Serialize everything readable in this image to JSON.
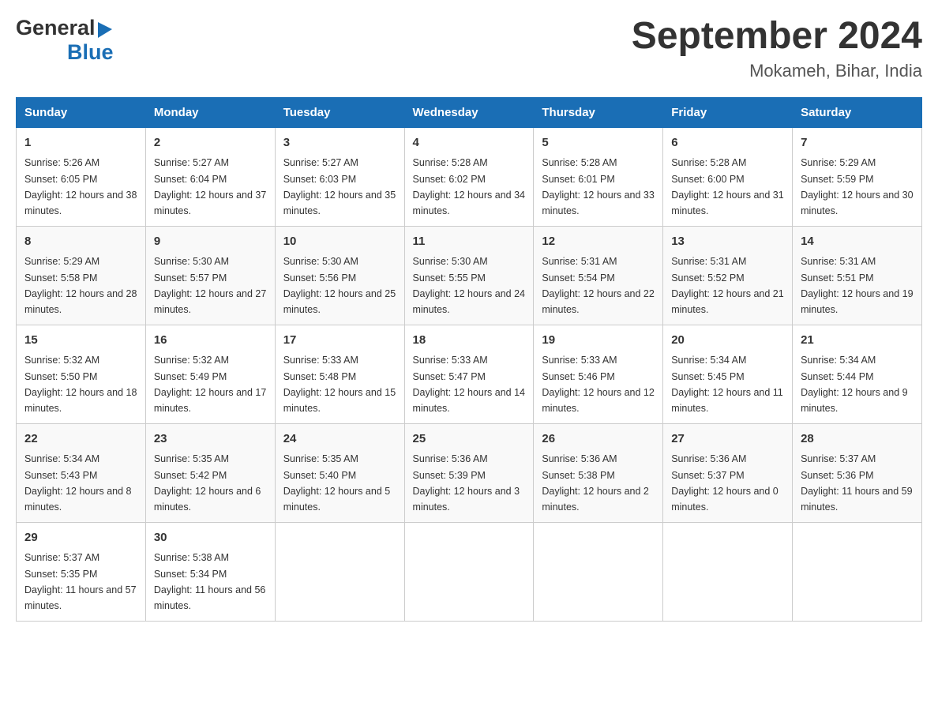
{
  "header": {
    "logo": {
      "general": "General",
      "blue": "Blue"
    },
    "title": "September 2024",
    "location": "Mokameh, Bihar, India"
  },
  "columns": [
    "Sunday",
    "Monday",
    "Tuesday",
    "Wednesday",
    "Thursday",
    "Friday",
    "Saturday"
  ],
  "weeks": [
    [
      {
        "day": "1",
        "sunrise": "5:26 AM",
        "sunset": "6:05 PM",
        "daylight": "12 hours and 38 minutes."
      },
      {
        "day": "2",
        "sunrise": "5:27 AM",
        "sunset": "6:04 PM",
        "daylight": "12 hours and 37 minutes."
      },
      {
        "day": "3",
        "sunrise": "5:27 AM",
        "sunset": "6:03 PM",
        "daylight": "12 hours and 35 minutes."
      },
      {
        "day": "4",
        "sunrise": "5:28 AM",
        "sunset": "6:02 PM",
        "daylight": "12 hours and 34 minutes."
      },
      {
        "day": "5",
        "sunrise": "5:28 AM",
        "sunset": "6:01 PM",
        "daylight": "12 hours and 33 minutes."
      },
      {
        "day": "6",
        "sunrise": "5:28 AM",
        "sunset": "6:00 PM",
        "daylight": "12 hours and 31 minutes."
      },
      {
        "day": "7",
        "sunrise": "5:29 AM",
        "sunset": "5:59 PM",
        "daylight": "12 hours and 30 minutes."
      }
    ],
    [
      {
        "day": "8",
        "sunrise": "5:29 AM",
        "sunset": "5:58 PM",
        "daylight": "12 hours and 28 minutes."
      },
      {
        "day": "9",
        "sunrise": "5:30 AM",
        "sunset": "5:57 PM",
        "daylight": "12 hours and 27 minutes."
      },
      {
        "day": "10",
        "sunrise": "5:30 AM",
        "sunset": "5:56 PM",
        "daylight": "12 hours and 25 minutes."
      },
      {
        "day": "11",
        "sunrise": "5:30 AM",
        "sunset": "5:55 PM",
        "daylight": "12 hours and 24 minutes."
      },
      {
        "day": "12",
        "sunrise": "5:31 AM",
        "sunset": "5:54 PM",
        "daylight": "12 hours and 22 minutes."
      },
      {
        "day": "13",
        "sunrise": "5:31 AM",
        "sunset": "5:52 PM",
        "daylight": "12 hours and 21 minutes."
      },
      {
        "day": "14",
        "sunrise": "5:31 AM",
        "sunset": "5:51 PM",
        "daylight": "12 hours and 19 minutes."
      }
    ],
    [
      {
        "day": "15",
        "sunrise": "5:32 AM",
        "sunset": "5:50 PM",
        "daylight": "12 hours and 18 minutes."
      },
      {
        "day": "16",
        "sunrise": "5:32 AM",
        "sunset": "5:49 PM",
        "daylight": "12 hours and 17 minutes."
      },
      {
        "day": "17",
        "sunrise": "5:33 AM",
        "sunset": "5:48 PM",
        "daylight": "12 hours and 15 minutes."
      },
      {
        "day": "18",
        "sunrise": "5:33 AM",
        "sunset": "5:47 PM",
        "daylight": "12 hours and 14 minutes."
      },
      {
        "day": "19",
        "sunrise": "5:33 AM",
        "sunset": "5:46 PM",
        "daylight": "12 hours and 12 minutes."
      },
      {
        "day": "20",
        "sunrise": "5:34 AM",
        "sunset": "5:45 PM",
        "daylight": "12 hours and 11 minutes."
      },
      {
        "day": "21",
        "sunrise": "5:34 AM",
        "sunset": "5:44 PM",
        "daylight": "12 hours and 9 minutes."
      }
    ],
    [
      {
        "day": "22",
        "sunrise": "5:34 AM",
        "sunset": "5:43 PM",
        "daylight": "12 hours and 8 minutes."
      },
      {
        "day": "23",
        "sunrise": "5:35 AM",
        "sunset": "5:42 PM",
        "daylight": "12 hours and 6 minutes."
      },
      {
        "day": "24",
        "sunrise": "5:35 AM",
        "sunset": "5:40 PM",
        "daylight": "12 hours and 5 minutes."
      },
      {
        "day": "25",
        "sunrise": "5:36 AM",
        "sunset": "5:39 PM",
        "daylight": "12 hours and 3 minutes."
      },
      {
        "day": "26",
        "sunrise": "5:36 AM",
        "sunset": "5:38 PM",
        "daylight": "12 hours and 2 minutes."
      },
      {
        "day": "27",
        "sunrise": "5:36 AM",
        "sunset": "5:37 PM",
        "daylight": "12 hours and 0 minutes."
      },
      {
        "day": "28",
        "sunrise": "5:37 AM",
        "sunset": "5:36 PM",
        "daylight": "11 hours and 59 minutes."
      }
    ],
    [
      {
        "day": "29",
        "sunrise": "5:37 AM",
        "sunset": "5:35 PM",
        "daylight": "11 hours and 57 minutes."
      },
      {
        "day": "30",
        "sunrise": "5:38 AM",
        "sunset": "5:34 PM",
        "daylight": "11 hours and 56 minutes."
      },
      null,
      null,
      null,
      null,
      null
    ]
  ]
}
